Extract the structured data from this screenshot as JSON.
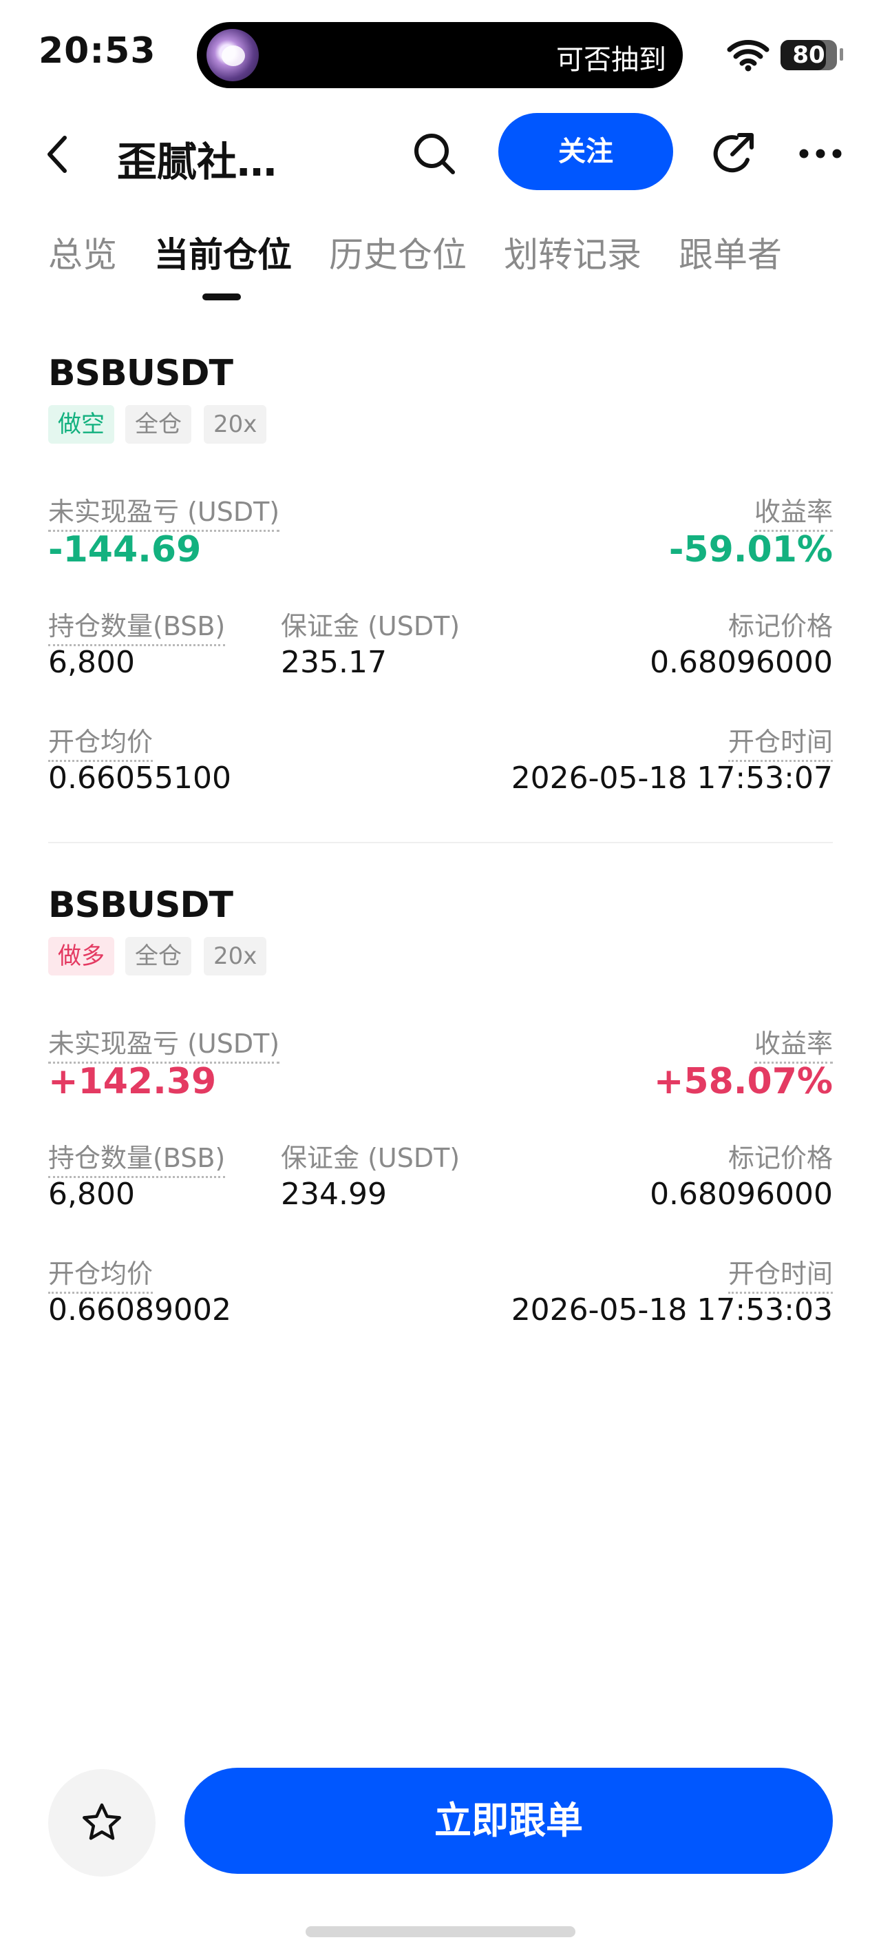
{
  "status_bar": {
    "time": "20:53",
    "island_text": "可否抽到",
    "battery_level": "80",
    "battery_fraction": 0.8
  },
  "nav": {
    "title": "歪腻社…",
    "follow_label": "关注"
  },
  "tabs": [
    {
      "label": "总览",
      "active": false
    },
    {
      "label": "当前仓位",
      "active": true
    },
    {
      "label": "历史仓位",
      "active": false
    },
    {
      "label": "划转记录",
      "active": false
    },
    {
      "label": "跟单者",
      "active": false
    }
  ],
  "positions": [
    {
      "symbol": "BSBUSDT",
      "side_tag": "做空",
      "margin_mode_tag": "全仓",
      "leverage_tag": "20x",
      "unrealized_pnl_label": "未实现盈亏 (USDT)",
      "unrealized_pnl": "-144.69",
      "roi_label": "收益率",
      "roi": "-59.01%",
      "quantity_label": "持仓数量(BSB)",
      "quantity": "6,800",
      "margin_label": "保证金 (USDT)",
      "margin": "235.17",
      "mark_price_label": "标记价格",
      "mark_price": "0.68096000",
      "entry_price_label": "开仓均价",
      "entry_price": "0.66055100",
      "open_time_label": "开仓时间",
      "open_time": "2026-05-18 17:53:07"
    },
    {
      "symbol": "BSBUSDT",
      "side_tag": "做多",
      "margin_mode_tag": "全仓",
      "leverage_tag": "20x",
      "unrealized_pnl_label": "未实现盈亏 (USDT)",
      "unrealized_pnl": "+142.39",
      "roi_label": "收益率",
      "roi": "+58.07%",
      "quantity_label": "持仓数量(BSB)",
      "quantity": "6,800",
      "margin_label": "保证金 (USDT)",
      "margin": "234.99",
      "mark_price_label": "标记价格",
      "mark_price": "0.68096000",
      "entry_price_label": "开仓均价",
      "entry_price": "0.66089002",
      "open_time_label": "开仓时间",
      "open_time": "2026-05-18 17:53:03"
    }
  ],
  "bottom": {
    "copy_trade_label": "立即跟单"
  },
  "colors": {
    "accent": "#0057ff",
    "loss_green": "#13b17f",
    "profit_red": "#e43a62"
  },
  "icons": [
    "wifi-icon",
    "back-icon",
    "search-icon",
    "share-icon",
    "more-icon",
    "star-icon"
  ]
}
